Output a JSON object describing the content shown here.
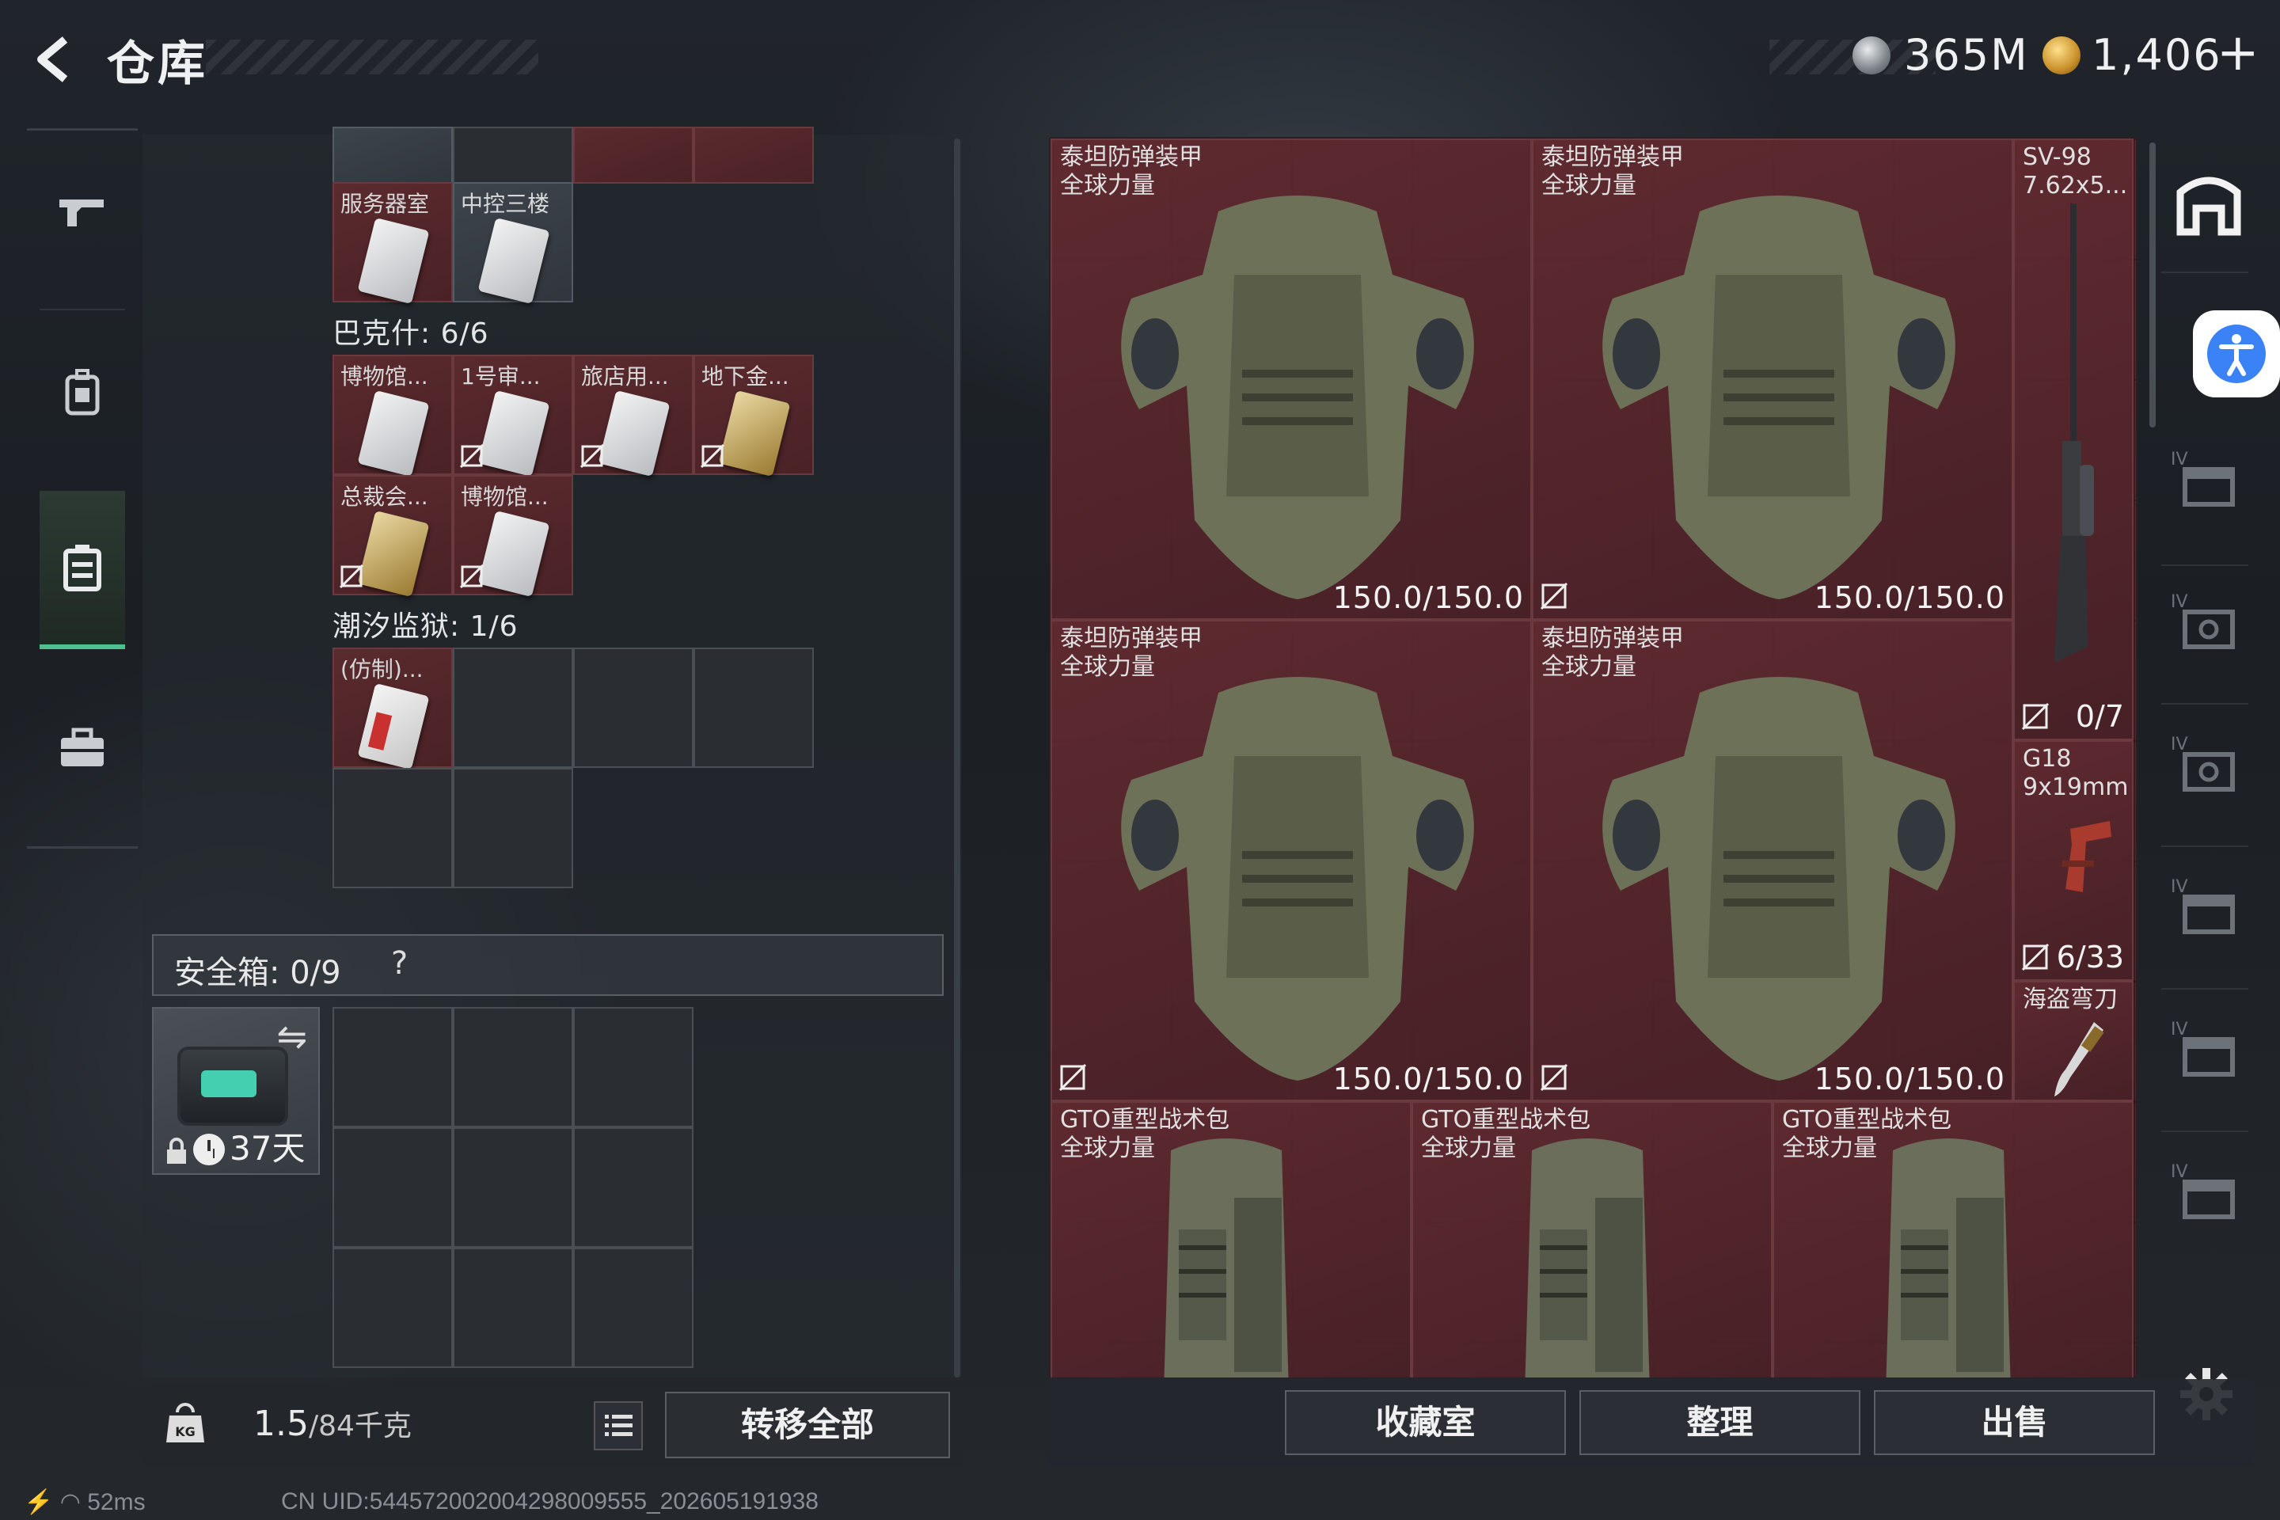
{
  "header": {
    "title": "仓库",
    "currency_silver": "365M",
    "currency_gold": "1,406",
    "plus_label": "+"
  },
  "stash": {
    "top_row_labels": [
      "服务器室",
      "中控三楼"
    ],
    "section_bakesh": "巴克什: 6/6",
    "bakesh_keys": [
      "博物馆...",
      "1号审...",
      "旅店用...",
      "地下金...",
      "总裁会...",
      "博物馆..."
    ],
    "section_prison": "潮汐监狱: 1/6",
    "prison_keys": [
      "(仿制)..."
    ],
    "safe_label": "安全箱: 0/9",
    "safe_help": "?",
    "safe_days": "37天",
    "weight_value": "1.5",
    "weight_max": "/84千克",
    "transfer_all": "转移全部"
  },
  "inventory": {
    "armor_name1": "泰坦防弹装甲",
    "armor_name2": "全球力量",
    "armor_durability": "150.0/150.0",
    "bag_name1": "GTO重型战术包",
    "bag_name2": "全球力量",
    "rifle_name1": "SV-98",
    "rifle_name2": "7.62x5...",
    "rifle_count": "0/7",
    "pistol_name1": "G18",
    "pistol_name2": "9x19mm",
    "pistol_count": "6/33",
    "knife_name": "海盗弯刀"
  },
  "bottom_buttons": {
    "collection": "收藏室",
    "sort": "整理",
    "sell": "出售"
  },
  "status": {
    "ping": "52ms",
    "uid": "CN UID:544572002004298009555_202605191938"
  },
  "colors": {
    "item_red": "#5b2a2f",
    "accent_green": "#4ec08f",
    "accessibility_blue": "#3b82f6"
  }
}
